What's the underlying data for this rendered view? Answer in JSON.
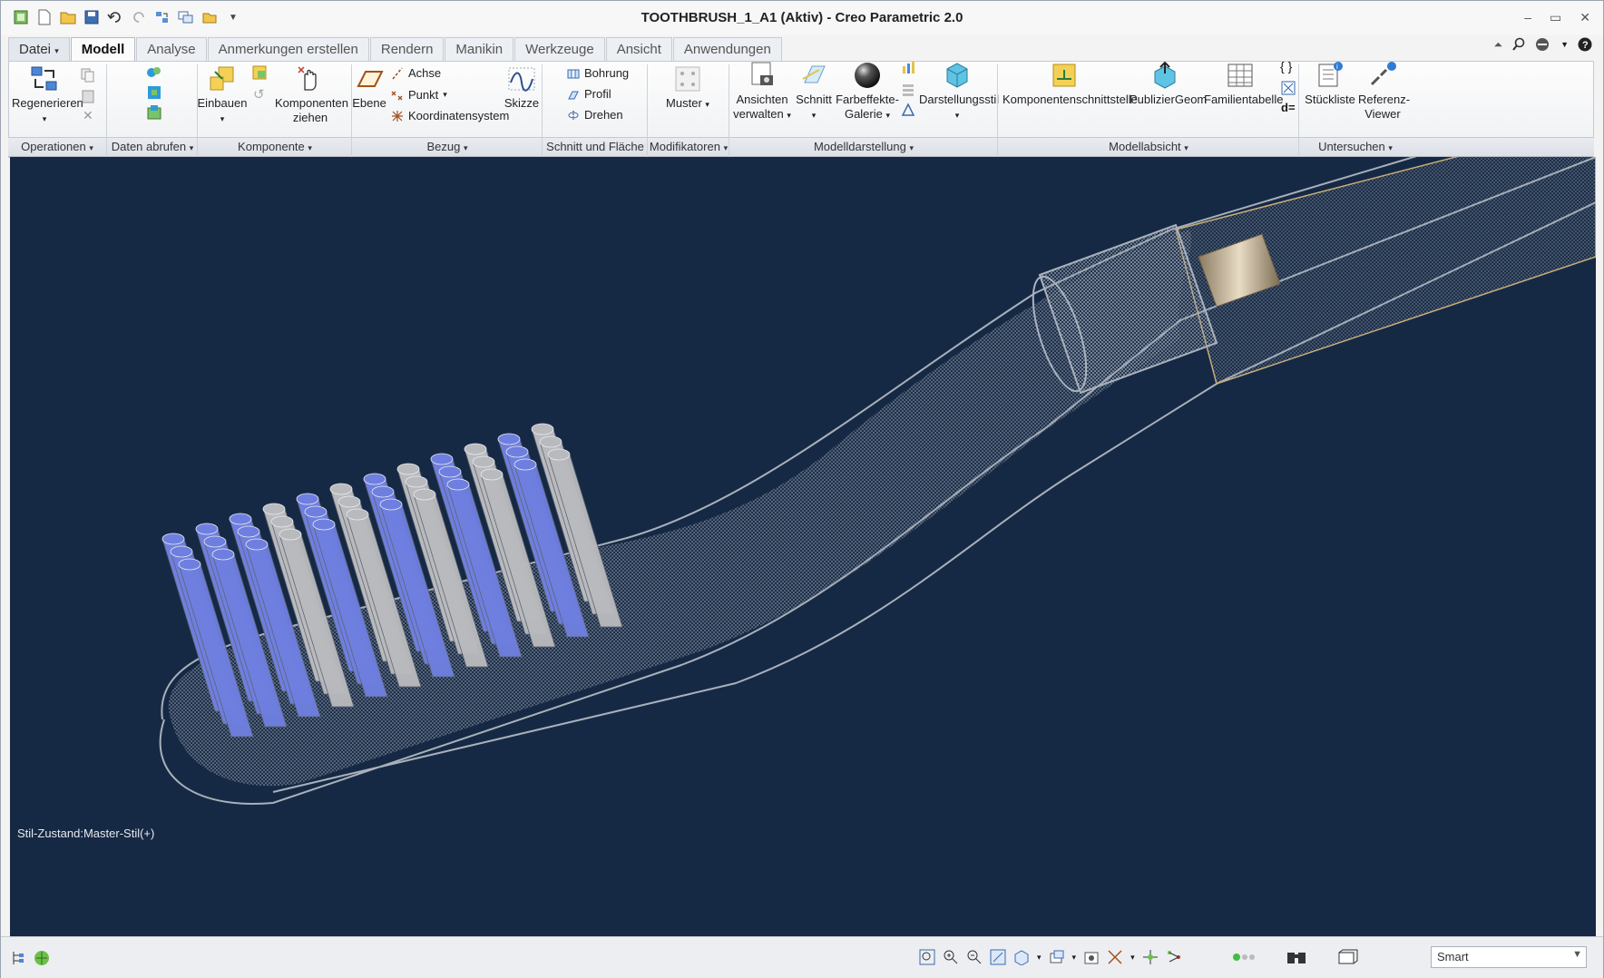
{
  "window": {
    "title": "TOOTHBRUSH_1_A1 (Aktiv) - Creo Parametric 2.0"
  },
  "tabs": [
    "Datei",
    "Modell",
    "Analyse",
    "Anmerkungen erstellen",
    "Rendern",
    "Manikin",
    "Werkzeuge",
    "Ansicht",
    "Anwendungen"
  ],
  "ribbon": {
    "regenerieren": "Regenerieren",
    "einbauen": "Einbauen",
    "komponenten_ziehen_1": "Komponenten",
    "komponenten_ziehen_2": "ziehen",
    "ebene": "Ebene",
    "achse": "Achse",
    "punkt": "Punkt",
    "koordinatensystem": "Koordinatensystem",
    "skizze": "Skizze",
    "bohrung": "Bohrung",
    "profil": "Profil",
    "drehen": "Drehen",
    "muster": "Muster",
    "ansichten_1": "Ansichten",
    "ansichten_2": "verwalten",
    "schnitt": "Schnitt",
    "farbeffekte_1": "Farbeffekte-",
    "farbeffekte_2": "Galerie",
    "darstellungsstil": "Darstellungsstil",
    "komponentenschnittstelle": "Komponentenschnittstelle",
    "publiziergeom": "PublizierGeom",
    "familientabelle": "Familientabelle",
    "stueckliste": "Stückliste",
    "referenz_1": "Referenz-",
    "referenz_2": "Viewer",
    "d_eq": "d="
  },
  "groups": [
    "Operationen",
    "Daten abrufen",
    "Komponente",
    "Bezug",
    "Schnitt und Fläche",
    "Modifikatoren",
    "Modelldarstellung",
    "Modellabsicht",
    "Untersuchen"
  ],
  "viewport": {
    "status": "Stil-Zustand:Master-Stil(+)",
    "background": "#162944"
  },
  "statusbar": {
    "filter": "Smart"
  },
  "colors": {
    "bristle_blue": "#6f7fe0",
    "bristle_gray": "#b9babd",
    "accent": "#3a7bd5"
  }
}
